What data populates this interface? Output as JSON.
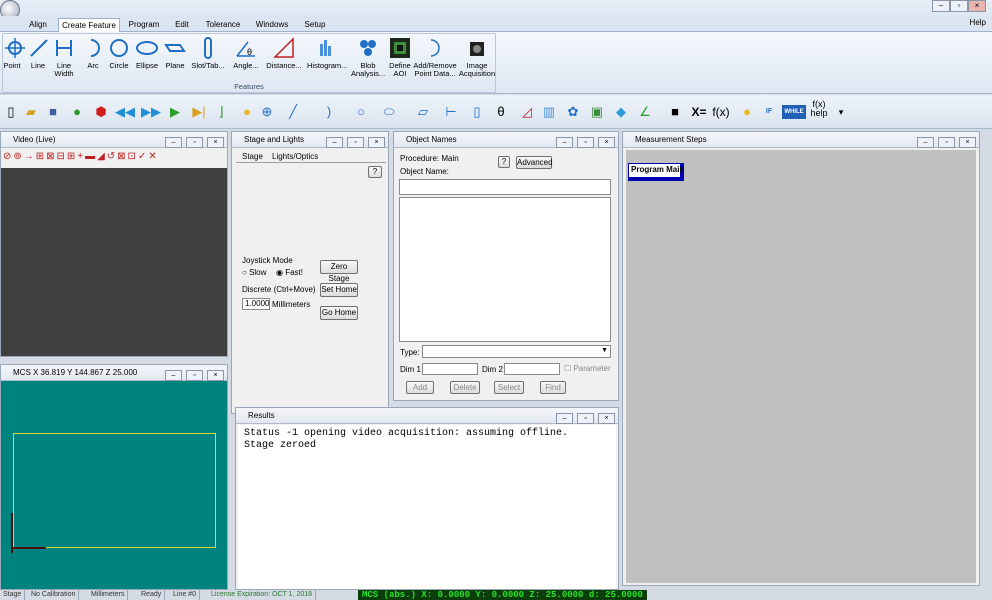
{
  "ribbon": {
    "tabs": [
      "Align",
      "Create Feature",
      "Program",
      "Edit",
      "Tolerance",
      "Windows",
      "Setup"
    ],
    "active_tab": "Create Feature",
    "help": "Help",
    "group_label": "Features",
    "buttons": [
      {
        "l1": "Point",
        "l2": ""
      },
      {
        "l1": "Line",
        "l2": ""
      },
      {
        "l1": "Line",
        "l2": "Width"
      },
      {
        "l1": "Arc",
        "l2": ""
      },
      {
        "l1": "Circle",
        "l2": ""
      },
      {
        "l1": "Ellipse",
        "l2": ""
      },
      {
        "l1": "Plane",
        "l2": ""
      },
      {
        "l1": "Slot/Tab...",
        "l2": ""
      },
      {
        "l1": "Angle...",
        "l2": ""
      },
      {
        "l1": "Distance...",
        "l2": ""
      },
      {
        "l1": "Histogram...",
        "l2": ""
      },
      {
        "l1": "Blob",
        "l2": "Analysis..."
      },
      {
        "l1": "Define",
        "l2": "AOI"
      },
      {
        "l1": "Add/Remove",
        "l2": "Point Data..."
      },
      {
        "l1": "Image",
        "l2": "Acquisition"
      }
    ]
  },
  "toolbar": {
    "x_equals": "X=",
    "fx": "f(x)",
    "fx_help_1": "f(x)",
    "fx_help_2": "help",
    "if": "IF",
    "while": "WHILE"
  },
  "video": {
    "title": "Video (Live)"
  },
  "stage": {
    "title": "Stage and Lights",
    "tabs": [
      "Stage",
      "Lights/Optics"
    ],
    "help": "?",
    "joystick_label": "Joystick Mode",
    "slow": "Slow",
    "fast": "Fast!",
    "zero_stage": "Zero Stage",
    "discrete_label": "Discrete (Ctrl+Move)",
    "set_home": "Set Home",
    "discrete_value": "1.0000",
    "units": "Millimeters",
    "go_home": "Go Home"
  },
  "objects": {
    "title": "Object Names",
    "procedure": "Procedure: Main",
    "object_name": "Object Name:",
    "help": "?",
    "advanced": "Advanced",
    "type_label": "Type:",
    "dim1": "Dim 1",
    "dim2": "Dim 2",
    "parameter": "Parameter",
    "add": "Add",
    "delete": "Delete",
    "select": "Select",
    "find": "Find"
  },
  "steps": {
    "title": "Measurement Steps",
    "program_main": "Program Main"
  },
  "mcs_panel": {
    "title": "MCS X 36.819 Y 144.867 Z 25.000"
  },
  "results": {
    "title": "Results",
    "lines": [
      "Status -1 opening video acquisition: assuming offline.",
      "Stage zeroed"
    ]
  },
  "status": {
    "items": [
      "Stage",
      "No Calibration",
      "Millimeters",
      "Ready",
      "Line #0",
      "License Expiration: OCT 1, 2018"
    ],
    "mcs": "MCS (abs.) X: 0.0000  Y: 0.0000  Z: 25.0000  d: 25.0000"
  },
  "colors": {
    "canvas": "#00827f",
    "video_bg": "#404040",
    "mcs_text": "#27e127",
    "program_main_border": "#0000b0"
  }
}
